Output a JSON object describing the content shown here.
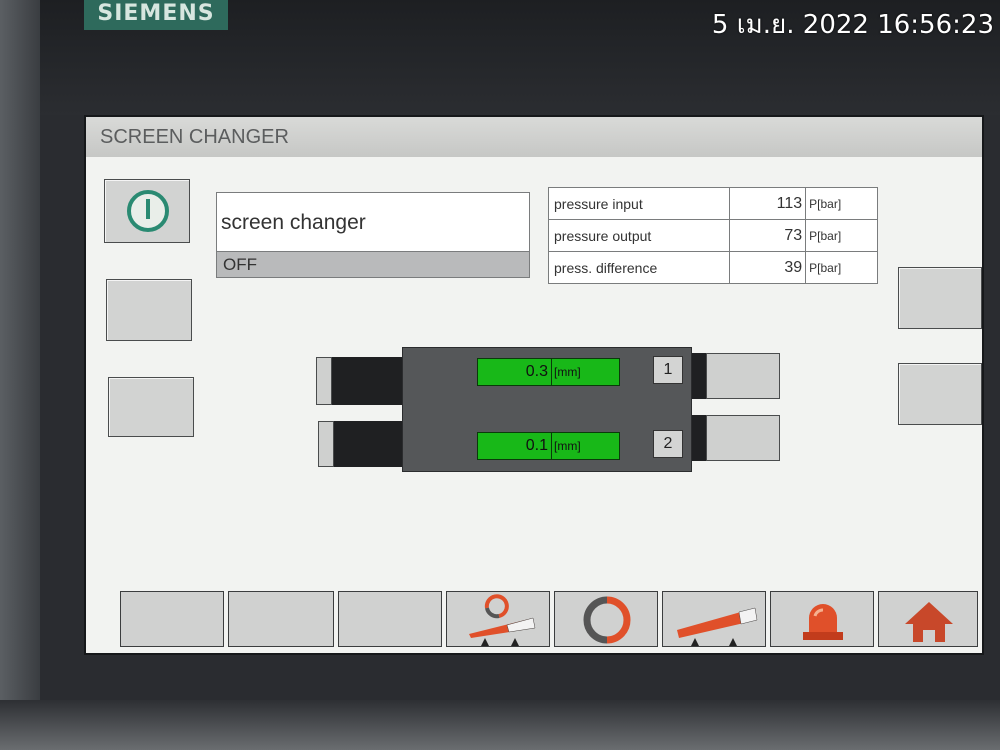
{
  "device": {
    "brand": "SIEMENS",
    "timestamp": "5 เม.ย. 2022 16:56:23"
  },
  "screen": {
    "title": "SCREEN CHANGER"
  },
  "status_panel": {
    "name": "screen changer",
    "state": "OFF"
  },
  "pressure": {
    "rows": [
      {
        "label": "pressure input",
        "value": "113",
        "unit": "P[bar]"
      },
      {
        "label": "pressure output",
        "value": "73",
        "unit": "P[bar]"
      },
      {
        "label": "press. difference",
        "value": "39",
        "unit": "P[bar]"
      }
    ]
  },
  "screens": [
    {
      "number": "1",
      "gap_value": "0.3",
      "gap_unit": "[mm]"
    },
    {
      "number": "2",
      "gap_value": "0.1",
      "gap_unit": "[mm]"
    }
  ],
  "icons": {
    "power": "power-icon",
    "tilt_rotate": "tilt-rotate-icon",
    "rotate": "rotate-icon",
    "ramp": "ramp-icon",
    "alarm": "alarm-beacon-icon",
    "home": "home-icon"
  },
  "colors": {
    "accent_green": "#18b818",
    "power_teal": "#2a8a72",
    "icon_orange": "#e0502a"
  }
}
